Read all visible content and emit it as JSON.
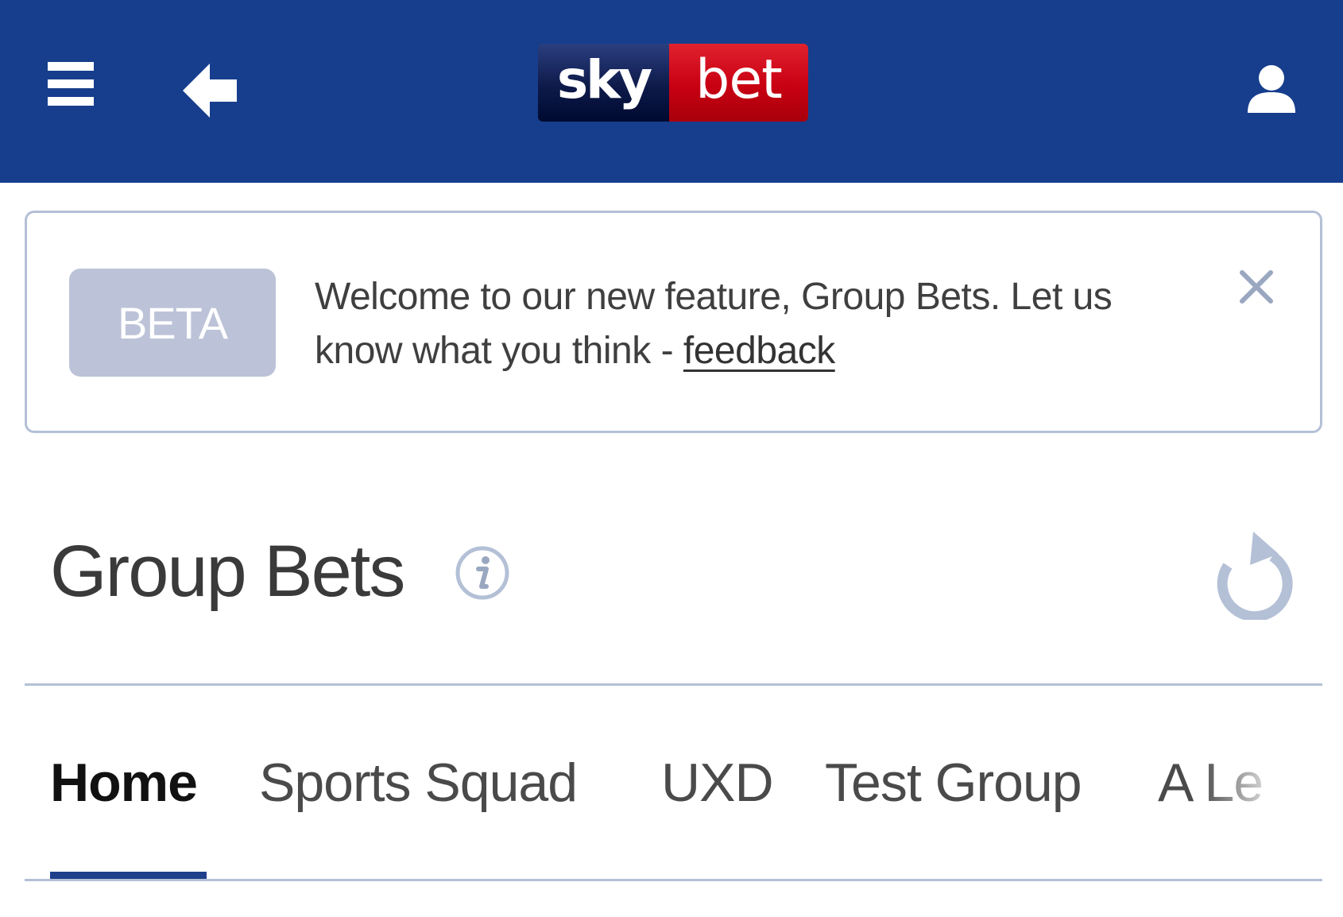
{
  "header": {
    "brand_left": "sky",
    "brand_right": "bet",
    "icons": [
      "menu-icon",
      "back-arrow-icon",
      "user-icon"
    ],
    "bg_color": "#173e8d"
  },
  "banner": {
    "badge": "BETA",
    "message": "Welcome to our new feature, Group Bets. Let us know what you think - ",
    "link_label": "feedback",
    "close_icon": "close-icon"
  },
  "page": {
    "title": "Group Bets",
    "info_icon": "info-icon",
    "refresh_icon": "refresh-icon"
  },
  "tabs": {
    "items": [
      {
        "label": "Home",
        "active": true
      },
      {
        "label": "Sports Squad",
        "active": false
      },
      {
        "label": "UXD",
        "active": false
      },
      {
        "label": "Test Group",
        "active": false
      },
      {
        "label": "A Le",
        "active": false
      }
    ],
    "indicator_color": "#1e3f8a"
  }
}
